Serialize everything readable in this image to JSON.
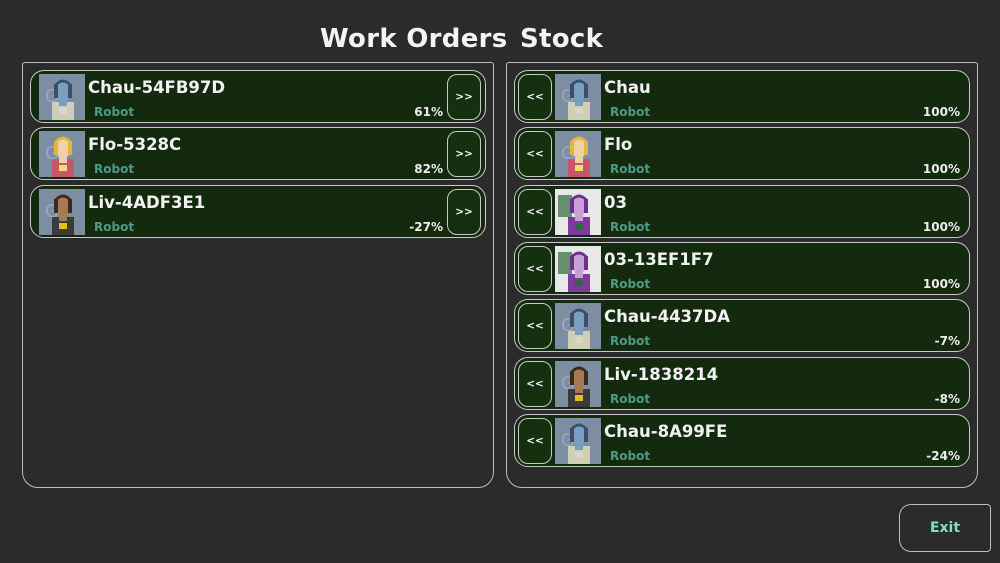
{
  "headers": {
    "work_orders": "Work Orders",
    "stock": "Stock"
  },
  "work_orders": [
    {
      "name": "Chau-54FB97D",
      "type": "Robot",
      "percent": "61%",
      "button": ">>",
      "portrait": "chau"
    },
    {
      "name": "Flo-5328C",
      "type": "Robot",
      "percent": "82%",
      "button": ">>",
      "portrait": "flo"
    },
    {
      "name": "Liv-4ADF3E1",
      "type": "Robot",
      "percent": "-27%",
      "button": ">>",
      "portrait": "liv"
    }
  ],
  "stock": [
    {
      "name": "Chau",
      "type": "Robot",
      "percent": "100%",
      "button": "<<",
      "portrait": "chau"
    },
    {
      "name": "Flo",
      "type": "Robot",
      "percent": "100%",
      "button": "<<",
      "portrait": "flo"
    },
    {
      "name": "03",
      "type": "Robot",
      "percent": "100%",
      "button": "<<",
      "portrait": "03"
    },
    {
      "name": "03-13EF1F7",
      "type": "Robot",
      "percent": "100%",
      "button": "<<",
      "portrait": "03"
    },
    {
      "name": "Chau-4437DA",
      "type": "Robot",
      "percent": "-7%",
      "button": "<<",
      "portrait": "chau"
    },
    {
      "name": "Liv-1838214",
      "type": "Robot",
      "percent": "-8%",
      "button": "<<",
      "portrait": "liv"
    },
    {
      "name": "Chau-8A99FE",
      "type": "Robot",
      "percent": "-24%",
      "button": "<<",
      "portrait": "chau"
    }
  ],
  "footer": {
    "exit_label": "Exit"
  },
  "colors": {
    "background": "#2b2b2b",
    "card_fill": "#142a0f",
    "type_text": "#4d9a86",
    "exit_text": "#7fe0c6"
  }
}
